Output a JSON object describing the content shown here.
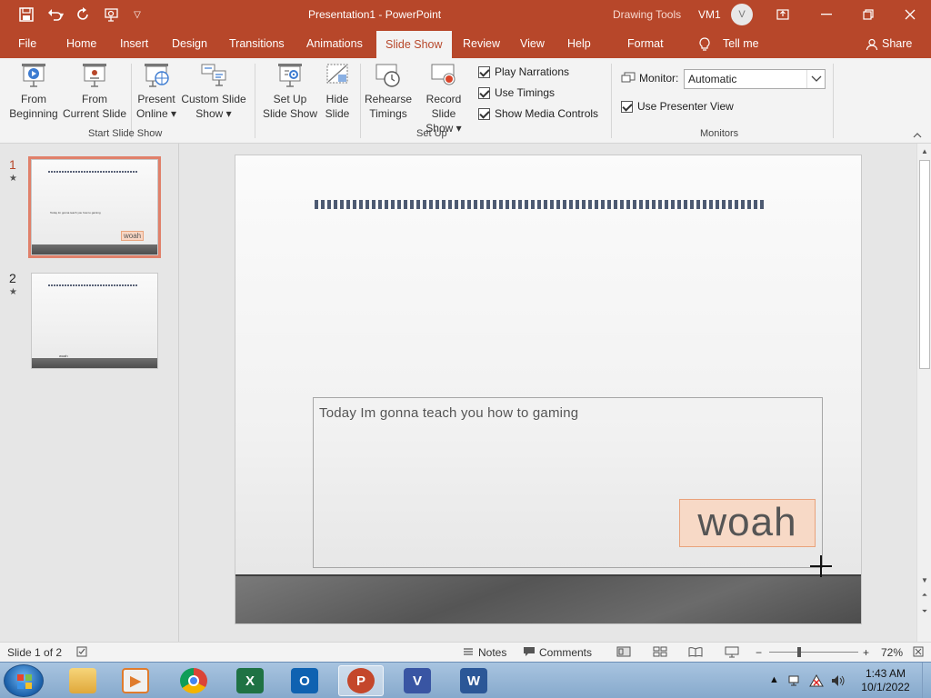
{
  "titlebar": {
    "title": "Presentation1  -  PowerPoint",
    "contextual_tools": "Drawing Tools",
    "user": "VM1",
    "avatar_initial": "V"
  },
  "tabs": [
    "File",
    "Home",
    "Insert",
    "Design",
    "Transitions",
    "Animations",
    "Slide Show",
    "Review",
    "View",
    "Help",
    "Format",
    "Tell me",
    "Share"
  ],
  "active_tab": "Slide Show",
  "ribbon": {
    "start_group": {
      "label": "Start Slide Show",
      "from_beginning": [
        "From",
        "Beginning"
      ],
      "from_current": [
        "From",
        "Current Slide"
      ],
      "present_online": [
        "Present",
        "Online"
      ],
      "custom_show": [
        "Custom Slide",
        "Show"
      ]
    },
    "setup_group": {
      "label": "Set Up",
      "setup_show": [
        "Set Up",
        "Slide Show"
      ],
      "hide_slide": [
        "Hide",
        "Slide"
      ],
      "rehearse": [
        "Rehearse",
        "Timings"
      ],
      "record": [
        "Record Slide",
        "Show"
      ],
      "play_narrations": "Play Narrations",
      "use_timings": "Use Timings",
      "show_media_controls": "Show Media Controls"
    },
    "monitors_group": {
      "label": "Monitors",
      "monitor_label": "Monitor:",
      "monitor_value": "Automatic",
      "presenter_view": "Use Presenter View"
    }
  },
  "thumbnails": [
    {
      "number": "1",
      "caption": "Today Im gonna teach you how to gaming",
      "badge": "woah"
    },
    {
      "number": "2",
      "caption": "woah"
    }
  ],
  "slide": {
    "body_text": "Today  Im gonna  teach  you  how  to  gaming",
    "woah_text": "woah"
  },
  "status": {
    "slide_count": "Slide 1 of 2",
    "notes": "Notes",
    "comments": "Comments",
    "zoom": "72%",
    "zoom_fraction": 0.72
  },
  "taskbar": {
    "time": "1:43 AM",
    "date": "10/1/2022"
  },
  "colors": {
    "accent": "#b7472a",
    "woah_fill": "#f7d9c6"
  }
}
